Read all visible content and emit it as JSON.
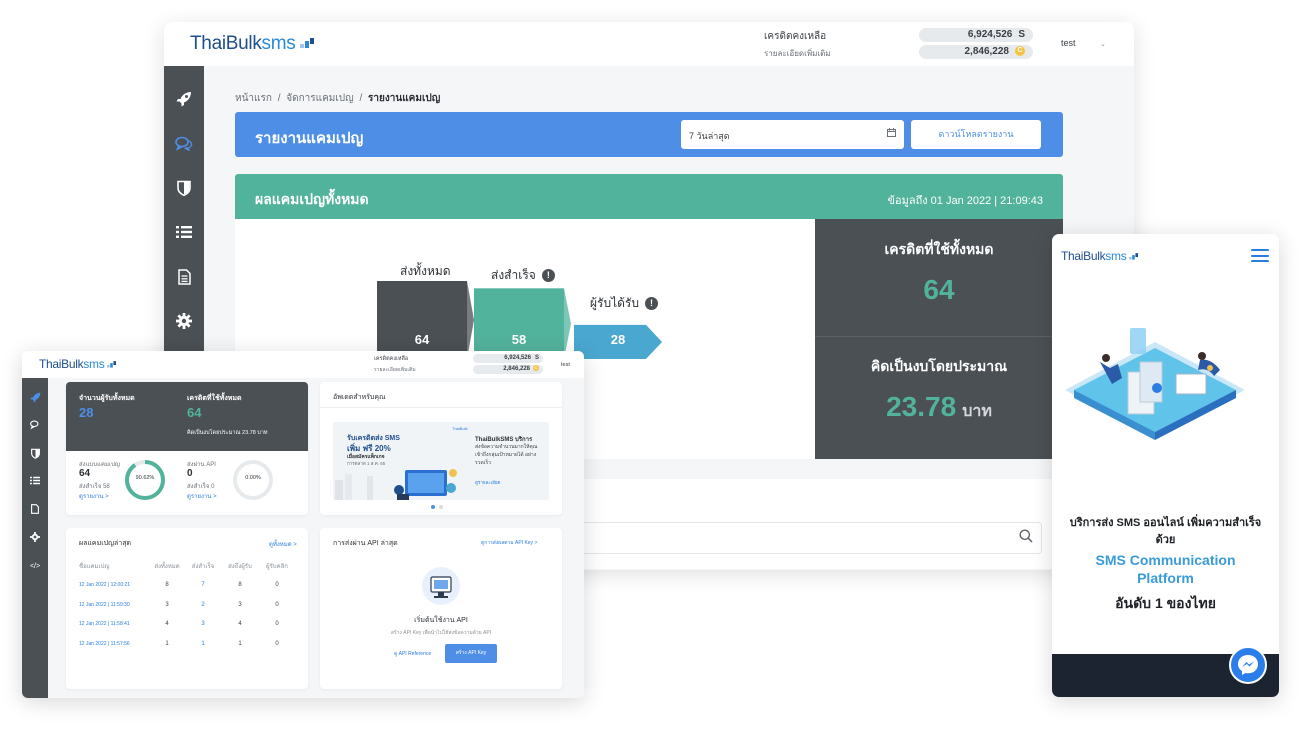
{
  "desktop": {
    "logo": {
      "part1": "ThaiBulk",
      "part2": "sms"
    },
    "header": {
      "credit_label": "เครดิตคงเหลือ",
      "credit_value": "6,924,526",
      "credit_unit": "S",
      "detail_label": "รายละเอียดเพิ่มเติม",
      "coin_value": "2,846,228",
      "coin_unit": "C",
      "user": "test"
    },
    "breadcrumb": {
      "home": "หน้าแรก",
      "manage": "จัดการแคมเปญ",
      "current": "รายงานแคมเปญ"
    },
    "report_bar": {
      "title": "รายงานแคมเปญ",
      "date_range": "7 วันล่าสุด",
      "download_label": "ดาวน์โหลดรายงาน"
    },
    "results": {
      "title": "ผลแคมเปญทั้งหมด",
      "updated": "ข้อมูลถึง 01 Jan 2022 | 21:09:43",
      "funnel": [
        {
          "label": "ส่งทั้งหมด",
          "value": 64,
          "color": "#4b5055",
          "info": false
        },
        {
          "label": "ส่งสำเร็จ",
          "value": 58,
          "color": "#52b39c",
          "info": true
        },
        {
          "label": "ผู้รับได้รับ",
          "value": 28,
          "color": "#4aa7cf",
          "info": true
        }
      ],
      "credit_used_label": "เครดิตที่ใช้ทั้งหมด",
      "credit_used_value": "64",
      "budget_label": "คิดเป็นงบโดยประมาณ",
      "budget_value": "23.78",
      "budget_unit": "บาท"
    }
  },
  "mini": {
    "header": {
      "credit_label": "เครดิตคงเหลือ",
      "credit_value": "6,924,526",
      "credit_unit": "S",
      "detail_label": "รายละเอียดเพิ่มเติม",
      "coin_value": "2,846,228",
      "coin_unit": "C",
      "user": "test"
    },
    "stats": {
      "recipients_label": "จำนวนผู้รับทั้งหมด",
      "recipients_value": "28",
      "credit_label": "เครดิตที่ใช้ทั้งหมด",
      "credit_value": "64",
      "budget_note": "คิดเป็นงบโดยประมาณ 23.78 บาท",
      "campaign_label": "ส่งแบบแคมเปญ",
      "campaign_value": "64",
      "campaign_success": "ส่งสำเร็จ 58",
      "campaign_link": "ดูรายงาน >",
      "campaign_percent": "90.62%",
      "campaign_ratio": 0.9062,
      "api_label": "ส่งผ่าน API",
      "api_value": "0",
      "api_success": "ส่งสำเร็จ 0",
      "api_link": "ดูรายงาน >",
      "api_percent": "0.00%",
      "api_ratio": 0
    },
    "updates": {
      "title": "อัพเดตสำหรับคุณ",
      "promo_line1": "รับเครดิตส่ง SMS",
      "promo_line2": "เพิ่ม ฟรี 20%",
      "promo_line3": "เมื่อสมัครแพ็กเกจ",
      "promo_line4": "การตลาด 1 ส.ค. 65",
      "tag": "ThaiBulk",
      "desc_title": "ThaiBulkSMS บริการ",
      "desc_body": "ส่งข้อความจำนวนมากให้คุณ เข้าถึงกลุ่มเป้าหมายได้ อย่างรวดเร็ว",
      "desc_link": "ดูรายละเอียด"
    },
    "latest": {
      "title": "ผลแคมเปญล่าสุด",
      "view_all": "ดูทั้งหมด >",
      "headers": [
        "ชื่อแคมเปญ",
        "ส่งทั้งหมด",
        "ส่งสำเร็จ",
        "ส่งถึงผู้รับ",
        "ผู้รับคลิก"
      ],
      "rows": [
        [
          "12 Jan 2022 | 12:00:21",
          "8",
          "7",
          "8",
          "0"
        ],
        [
          "12 Jan 2022 | 11:59:30",
          "3",
          "2",
          "3",
          "0"
        ],
        [
          "12 Jan 2022 | 11:58:41",
          "4",
          "3",
          "4",
          "0"
        ],
        [
          "12 Jan 2022 | 11:57:56",
          "1",
          "1",
          "1",
          "0"
        ]
      ]
    },
    "api": {
      "title": "การส่งผ่าน API ล่าสุด",
      "manage_link": "ดูการส่งผลตาม API Key >",
      "start_title": "เริ่มต้นใช้งาน API",
      "start_desc": "สร้าง API Key เพื่อนำไปใช้ส่งข้อความด้วย API",
      "ref_link": "ดู API Reference",
      "create_btn": "สร้าง API Key"
    }
  },
  "mobile": {
    "tagline_1": "บริการส่ง SMS ออนไลน์ เพิ่มความสำเร็จ",
    "tagline_2": "ด้วย",
    "platform_1": "SMS Communication",
    "platform_2": "Platform",
    "rank": "อันดับ 1 ของไทย"
  },
  "colors": {
    "blue": "#4e8ee6",
    "green": "#52b39c",
    "dark": "#4b5055",
    "sky": "#4aa7cf"
  },
  "icons": [
    "rocket-icon",
    "chat-icon",
    "shield-icon",
    "list-icon",
    "document-icon",
    "gear-icon",
    "code-icon",
    "calendar-icon",
    "search-icon",
    "menu-icon",
    "messenger-icon",
    "chevron-down-icon"
  ]
}
